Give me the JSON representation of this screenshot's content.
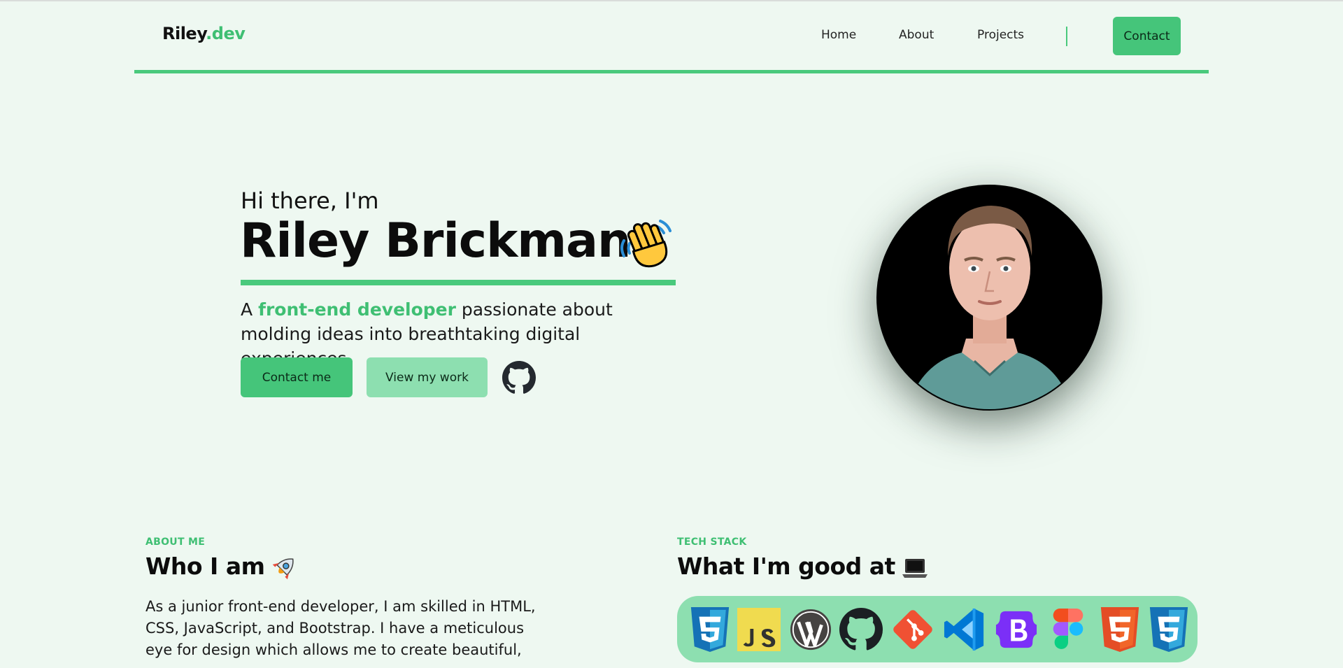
{
  "nav": {
    "logo_main": "Riley",
    "logo_accent": ".dev",
    "links": [
      "Home",
      "About",
      "Projects"
    ],
    "cta": "Contact"
  },
  "hero": {
    "greeting": "Hi there, I'm",
    "name": "Riley Brickman",
    "tagline_prefix": "A ",
    "tagline_highlight": "front-end developer",
    "tagline_suffix": " passionate about molding ideas into breathtaking digital experiences.",
    "btn_contact": "Contact me",
    "btn_work": "View my work",
    "github_icon": "github-icon",
    "wave_icon": "waving-hand-icon"
  },
  "about": {
    "eyebrow": "ABOUT ME",
    "title": "Who I am",
    "title_icon": "rocket-icon",
    "text": "As a junior front-end developer, I am skilled in HTML, CSS, JavaScript, and Bootstrap. I have a meticulous eye for design which allows me to create beautiful,"
  },
  "tech": {
    "eyebrow": "TECH STACK",
    "title": "What I'm good at",
    "title_icon": "laptop-icon",
    "icons": [
      "css3-icon",
      "javascript-icon",
      "wordpress-icon",
      "github-icon",
      "git-icon",
      "vscode-icon",
      "bootstrap-icon",
      "figma-icon",
      "html5-icon",
      "css3-icon"
    ]
  },
  "colors": {
    "background": "#eef8f1",
    "accent": "#45c57a",
    "accent_light": "#8ddfb0"
  }
}
